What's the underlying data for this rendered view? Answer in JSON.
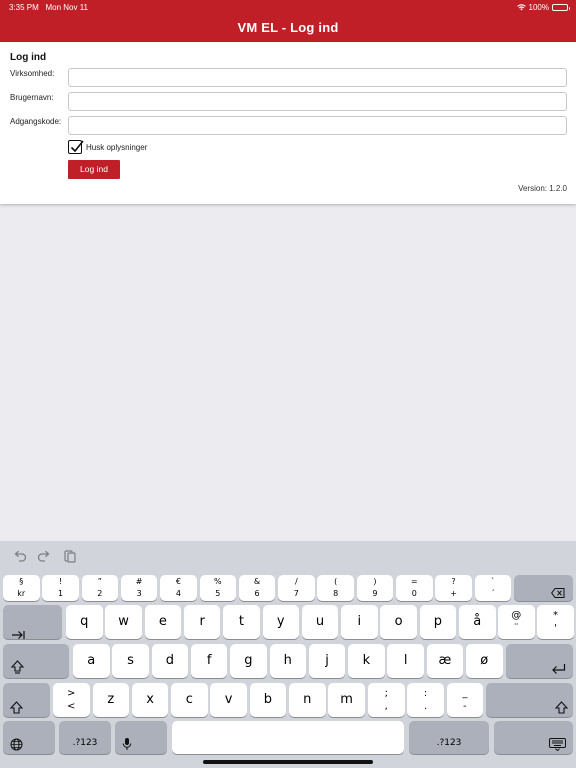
{
  "status_bar": {
    "time": "3:35 PM",
    "date": "Mon Nov 11",
    "battery": "100%"
  },
  "header": {
    "title": "VM EL - Log ind"
  },
  "form": {
    "title": "Log ind",
    "fields": [
      {
        "label": "Virksomhed:",
        "value": ""
      },
      {
        "label": "Brugernavn:",
        "value": ""
      },
      {
        "label": "Adgangskode:",
        "value": ""
      }
    ],
    "remember_label": "Husk oplysninger",
    "remember_checked": true,
    "login_button": "Log ind",
    "version": "Version: 1.2.0"
  },
  "keyboard": {
    "number_row": [
      {
        "top": "§",
        "bottom": "kr"
      },
      {
        "top": "!",
        "bottom": "1"
      },
      {
        "top": "”",
        "bottom": "2"
      },
      {
        "top": "#",
        "bottom": "3"
      },
      {
        "top": "€",
        "bottom": "4"
      },
      {
        "top": "%",
        "bottom": "5"
      },
      {
        "top": "&",
        "bottom": "6"
      },
      {
        "top": "/",
        "bottom": "7"
      },
      {
        "top": "(",
        "bottom": "8"
      },
      {
        "top": ")",
        "bottom": "9"
      },
      {
        "top": "=",
        "bottom": "0"
      },
      {
        "top": "?",
        "bottom": "+"
      },
      {
        "top": "`",
        "bottom": "´"
      }
    ],
    "row1": [
      "q",
      "w",
      "e",
      "r",
      "t",
      "y",
      "u",
      "i",
      "o",
      "p",
      "å"
    ],
    "row1_dual": [
      {
        "top": "@",
        "bottom": "¨"
      },
      {
        "top": "*",
        "bottom": "'"
      }
    ],
    "row2": [
      "a",
      "s",
      "d",
      "f",
      "g",
      "h",
      "j",
      "k",
      "l",
      "æ",
      "ø"
    ],
    "row3_first": {
      "top": ">",
      "bottom": "<"
    },
    "row3": [
      "z",
      "x",
      "c",
      "v",
      "b",
      "n",
      "m"
    ],
    "row3_dual": [
      {
        "top": ";",
        "bottom": ","
      },
      {
        "top": ":",
        "bottom": "."
      },
      {
        "top": "_",
        "bottom": "-"
      }
    ],
    "numbers_label": ".?123",
    "icons": [
      "undo-icon",
      "redo-icon",
      "paste-icon",
      "delete-icon",
      "tab-icon",
      "caps-lock-icon",
      "return-icon",
      "shift-icon",
      "globe-icon",
      "microphone-icon",
      "keyboard-dismiss-icon"
    ]
  }
}
